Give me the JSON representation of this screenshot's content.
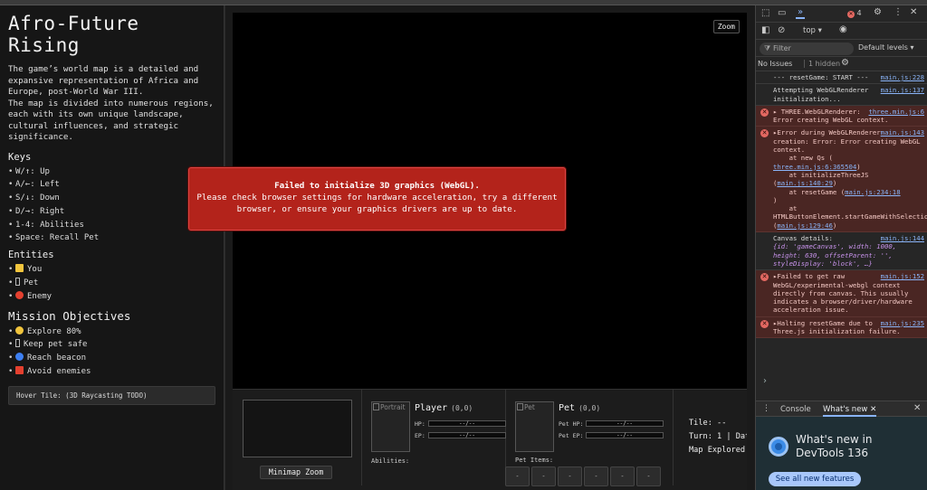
{
  "game": {
    "title": "Afro-Future Rising",
    "intro": "The game’s world map is a detailed and expansive representation of Africa and Europe, post-World War III.",
    "intro2": "The map is divided into numerous regions, each with its own unique landscape, cultural influences, and strategic significance.",
    "keys_heading": "Keys",
    "keys": [
      "W/↑: Up",
      "A/←: Left",
      "S/↓: Down",
      "D/→: Right",
      "1-4: Abilities",
      "Space: Recall Pet"
    ],
    "entities_heading": "Entities",
    "entities": [
      {
        "label": "You",
        "color": "#f2c53d",
        "shape": "square"
      },
      {
        "label": "Pet",
        "color": "",
        "shape": "box"
      },
      {
        "label": "Enemy",
        "color": "#e4402f",
        "shape": "circle"
      }
    ],
    "objectives_heading": "Mission Objectives",
    "objectives": [
      {
        "label": "Explore 80%",
        "color": "#f2c53d",
        "shape": "circle"
      },
      {
        "label": "Keep pet safe",
        "color": "",
        "shape": "box"
      },
      {
        "label": "Reach beacon",
        "color": "#3d7ff2",
        "shape": "circle"
      },
      {
        "label": "Avoid enemies",
        "color": "#e4402f",
        "shape": "square"
      }
    ],
    "hover_tile": "Hover Tile: (3D Raycasting TODO)",
    "zoom_label": "Zoom",
    "error_title": "Failed to initialize 3D graphics (WebGL).",
    "error_body": "Please check browser settings for hardware acceleration, try a different browser, or ensure your graphics drivers are up to date.",
    "hud": {
      "minimap_zoom": "Minimap Zoom",
      "portrait_alt": "Portrait",
      "player_name": "Player",
      "player_coord": "(0,0)",
      "hp_label": "HP:",
      "ep_label": "EP:",
      "bar_text": "--/--",
      "abilities_label": "Abilities:",
      "pet_alt": "Pet",
      "pet_name": "Pet",
      "pet_coord": "(0,0)",
      "pet_hp_label": "Pet HP:",
      "pet_ep_label": "Pet EP:",
      "pet_items_label": "Pet Items:",
      "slot_label": "-",
      "tile": "Tile: --",
      "turn": "Turn: 1 | Dat",
      "explored": "Map Explored:"
    }
  },
  "devtools": {
    "error_count": "4",
    "context": "top",
    "filter_placeholder": "Filter",
    "levels": "Default levels",
    "no_issues": "No Issues",
    "hidden": "1 hidden",
    "console_tab": "Console",
    "whats_new_tab": "What's new",
    "whats_new_title": "What's new in DevTools 136",
    "see_all": "See all new features",
    "log": [
      {
        "type": "log",
        "link": "main.js:228",
        "text": "--- resetGame: START ---"
      },
      {
        "type": "log",
        "link": "main.js:137",
        "text": "Attempting WebGLRenderer initialization..."
      },
      {
        "type": "error",
        "link": "three.min.js:6",
        "text": "THREE.WebGLRenderer: Error creating WebGL context."
      },
      {
        "type": "error",
        "link": "main.js:143",
        "text": "Error during WebGLRenderer creation: Error: Error creating WebGL context.",
        "trace": [
          "at new Qs (",
          "three.min.js:6:365504",
          ")",
          "at initializeThreeJS (",
          "main.js:140:29",
          ")",
          "at resetGame (",
          "main.js:234:18",
          ")",
          "at HTMLButtonElement.startGameWithSelections (",
          "main.js:129:46",
          ")"
        ]
      },
      {
        "type": "log",
        "link": "main.js:144",
        "text": "Canvas details:",
        "obj": "{id: 'gameCanvas', width: 1000, height: 630, offsetParent: '', styleDisplay: 'block', …}"
      },
      {
        "type": "error",
        "link": "main.js:152",
        "text": "Failed to get raw WebGL/experimental-webgl context directly from canvas. This usually indicates a browser/driver/hardware acceleration issue."
      },
      {
        "type": "error",
        "link": "main.js:235",
        "text": "Halting resetGame due to Three.js initialization failure."
      }
    ]
  }
}
